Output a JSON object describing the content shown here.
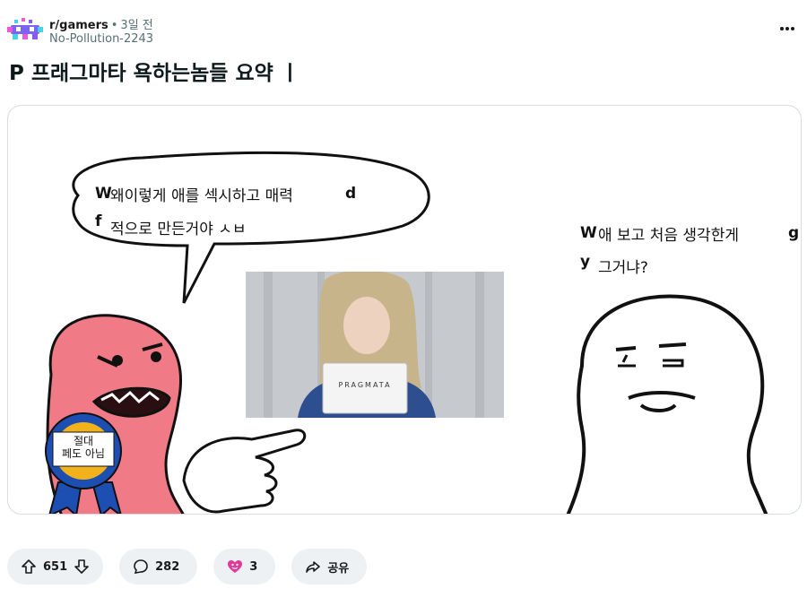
{
  "post": {
    "subreddit": "r/gamers",
    "separator": "•",
    "time": "3일 전",
    "author": "No-Pollution-2243",
    "title": "P 프래그마타 욕하는놈들 요약 ㅣ"
  },
  "meme": {
    "speech_line1": "왜이렇게 애를 섹시하고 매력",
    "speech_line2": "적으로 만든거야 ㅅㅂ",
    "reply_line1": "애 보고 처음 생각한게",
    "reply_line2": "그거냐?",
    "ribbon_line1": "절대",
    "ribbon_line2": "페도 아님",
    "sign_text": "PRAGMATA",
    "fragments": [
      "W",
      "f",
      "d",
      "W",
      "y",
      "g"
    ]
  },
  "actions": {
    "upvotes": "651",
    "comments": "282",
    "awards": "3",
    "share": "공유"
  },
  "colors": {
    "meta_gray": "#576f76",
    "pill_bg": "#eef1f3",
    "angry_pink": "#f07a86",
    "ribbon_blue": "#1d4fb3",
    "ribbon_gold": "#f2b21c",
    "award_pink": "#e0399a"
  },
  "icons": [
    "subreddit-avatar-icon",
    "more-options-icon",
    "upvote-icon",
    "downvote-icon",
    "comment-icon",
    "award-icon",
    "share-icon"
  ]
}
